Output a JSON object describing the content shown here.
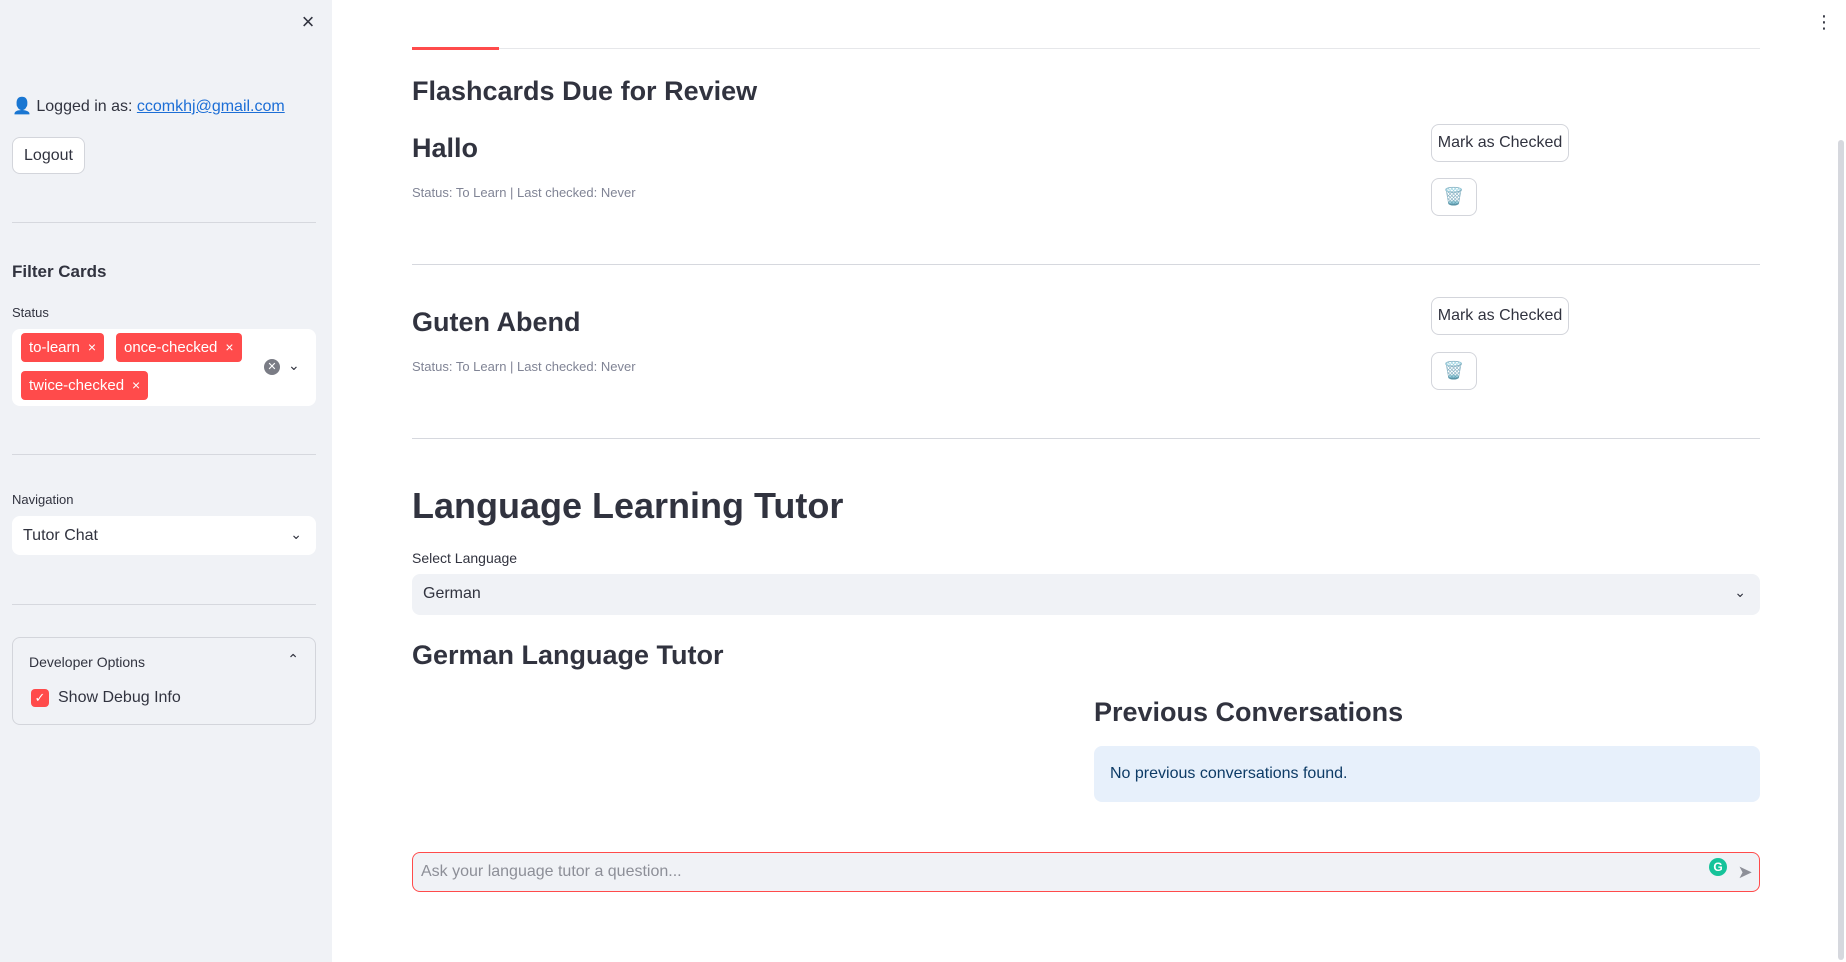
{
  "sidebar": {
    "close_icon": "×",
    "login_prefix": "👤 Logged in as: ",
    "login_email": "ccomkhj@gmail.com",
    "logout_label": "Logout",
    "filter_heading": "Filter Cards",
    "status_label": "Status",
    "status_chips": [
      "to-learn",
      "once-checked",
      "twice-checked"
    ],
    "chip_remove": "×",
    "navigation_label": "Navigation",
    "navigation_value": "Tutor Chat",
    "developer_options": {
      "title": "Developer Options",
      "show_debug_label": "Show Debug Info",
      "show_debug_checked": true
    }
  },
  "main": {
    "flashcards_heading": "Flashcards Due for Review",
    "cards": [
      {
        "word": "Hallo",
        "status": "Status: To Learn | Last checked: Never",
        "mark_label": "Mark as Checked",
        "delete_icon": "🗑️"
      },
      {
        "word": "Guten Abend",
        "status": "Status: To Learn | Last checked: Never",
        "mark_label": "Mark as Checked",
        "delete_icon": "🗑️"
      }
    ],
    "tutor_heading": "Language Learning Tutor",
    "select_language_label": "Select Language",
    "selected_language": "German",
    "german_heading": "German Language Tutor",
    "previous_heading": "Previous Conversations",
    "no_previous": "No previous conversations found.",
    "chat_placeholder": "Ask your language tutor a question...",
    "grammarly_icon": "G",
    "send_icon": "➤"
  },
  "app": {
    "menu_icon": "⋮"
  },
  "colors": {
    "accent": "#ff4b4b",
    "sidebar_bg": "#f0f2f6",
    "info_bg": "#e7f0fb",
    "link": "#1c6ed6"
  }
}
